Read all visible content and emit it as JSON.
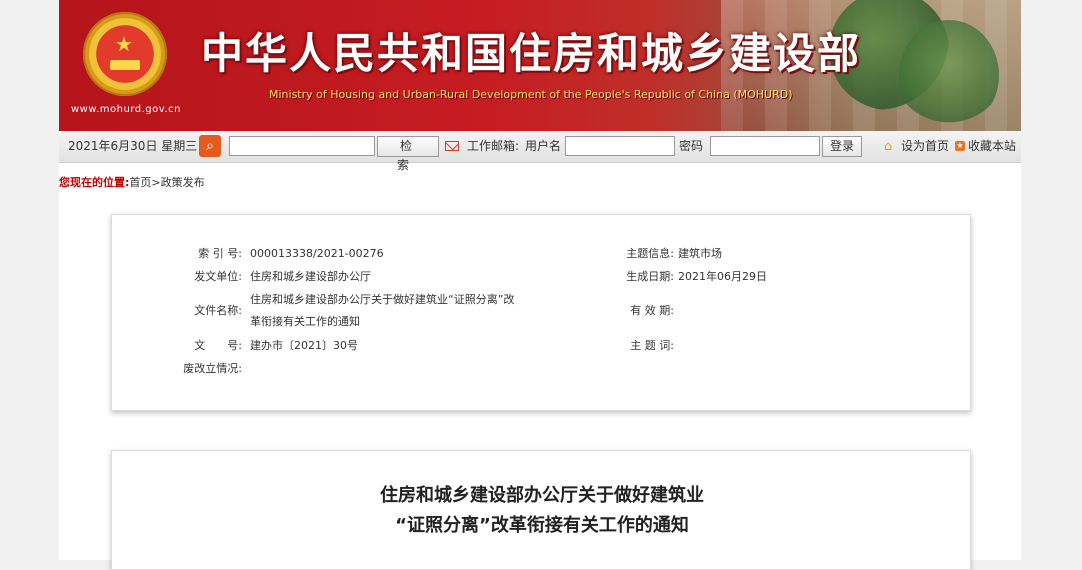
{
  "header": {
    "site_url": "www.mohurd.gov.cn",
    "title_cn": "中华人民共和国住房和城乡建设部",
    "title_en": "Ministry of Housing and Urban-Rural Development of the People's Republic of China (MOHURD)"
  },
  "toolbar": {
    "date": "2021年6月30日 星期三",
    "search_value": "",
    "search_button": "检 索",
    "mail_label": "工作邮箱:",
    "user_label": "用户名",
    "user_value": "",
    "password_label": "密码",
    "password_value": "",
    "login_button": "登录",
    "set_home": "设为首页",
    "bookmark": "收藏本站"
  },
  "breadcrumb": {
    "lead": "您现在的位置:",
    "path": "首页>政策发布"
  },
  "metadata": {
    "index_label": "索 引 号:",
    "index_value": "000013338/2021-00276",
    "topic_label": "主题信息:",
    "topic_value": "建筑市场",
    "issuer_label": "发文单位:",
    "issuer_value": "住房和城乡建设部办公厅",
    "date_label": "生成日期:",
    "date_value": "2021年06月29日",
    "doc_name_label": "文件名称:",
    "doc_name_line1": "住房和城乡建设部办公厅关于做好建筑业“证照分离”改",
    "doc_name_line2": "革衔接有关工作的通知",
    "validity_label": "有 效 期:",
    "doc_no_label": "文　　号:",
    "doc_no_value": "建办市〔2021〕30号",
    "keywords_label": "主 题 词:",
    "status_label": "废改立情况:"
  },
  "article": {
    "title_line1": "住房和城乡建设部办公厅关于做好建筑业",
    "title_line2": "“证照分离”改革衔接有关工作的通知"
  }
}
